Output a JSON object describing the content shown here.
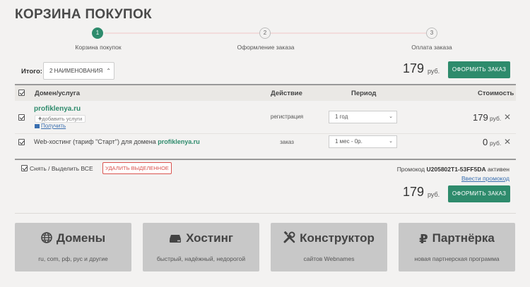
{
  "page_title": "КОРЗИНА ПОКУПОК",
  "steps": [
    {
      "number": "1",
      "label": "Корзина покупок"
    },
    {
      "number": "2",
      "label": "Оформление заказа"
    },
    {
      "number": "3",
      "label": "Оплата заказа"
    }
  ],
  "summary": {
    "itogo_label": "Итого:",
    "count_label": "2 НАИМЕНОВАНИЯ",
    "total": "179",
    "currency": "руб.",
    "order_button": "ОФОРМИТЬ ЗАКАЗ"
  },
  "table": {
    "headers": {
      "service": "Домен/услуга",
      "action": "Действие",
      "period": "Период",
      "price": "Стоимость"
    },
    "rows": [
      {
        "domain": "profiklenya.ru",
        "add_services": "добавить услуги",
        "get_link": "Получить",
        "action": "регистрация",
        "period": "1 год",
        "price": "179",
        "currency": "руб."
      },
      {
        "text_prefix": "Web-хостинг (тариф \"Старт\") для домена ",
        "domain": "profiklenya.ru",
        "action": "заказ",
        "period": "1 мес - 0р.",
        "price": "0",
        "currency": "руб."
      }
    ]
  },
  "bottom": {
    "select_all": "Снять / Выделить ВСЕ",
    "delete_selected": "УДАЛИТЬ ВЫДЕЛЕННОЕ",
    "promo_prefix": "Промокод ",
    "promo_code": "U205802T1-53FF5DA",
    "promo_suffix": " активен",
    "enter_promo": "Ввести промокод",
    "total": "179",
    "currency": "руб.",
    "order_button": "ОФОРМИТЬ ЗАКАЗ"
  },
  "tiles": [
    {
      "icon": "globe-icon",
      "title": "Домены",
      "subtitle": "ru, com, рф, рус и другие"
    },
    {
      "icon": "server-icon",
      "title": "Хостинг",
      "subtitle": "быстрый, надёжный, недорогой"
    },
    {
      "icon": "tools-icon",
      "title": "Конструктор",
      "subtitle": "сайтов Webnames"
    },
    {
      "icon": "ruble-icon",
      "title": "Партнёрка",
      "subtitle": "новая партнерская программа"
    }
  ],
  "colors": {
    "accent": "#2e8b6c",
    "danger": "#d9534f",
    "link": "#3a6fb0"
  }
}
